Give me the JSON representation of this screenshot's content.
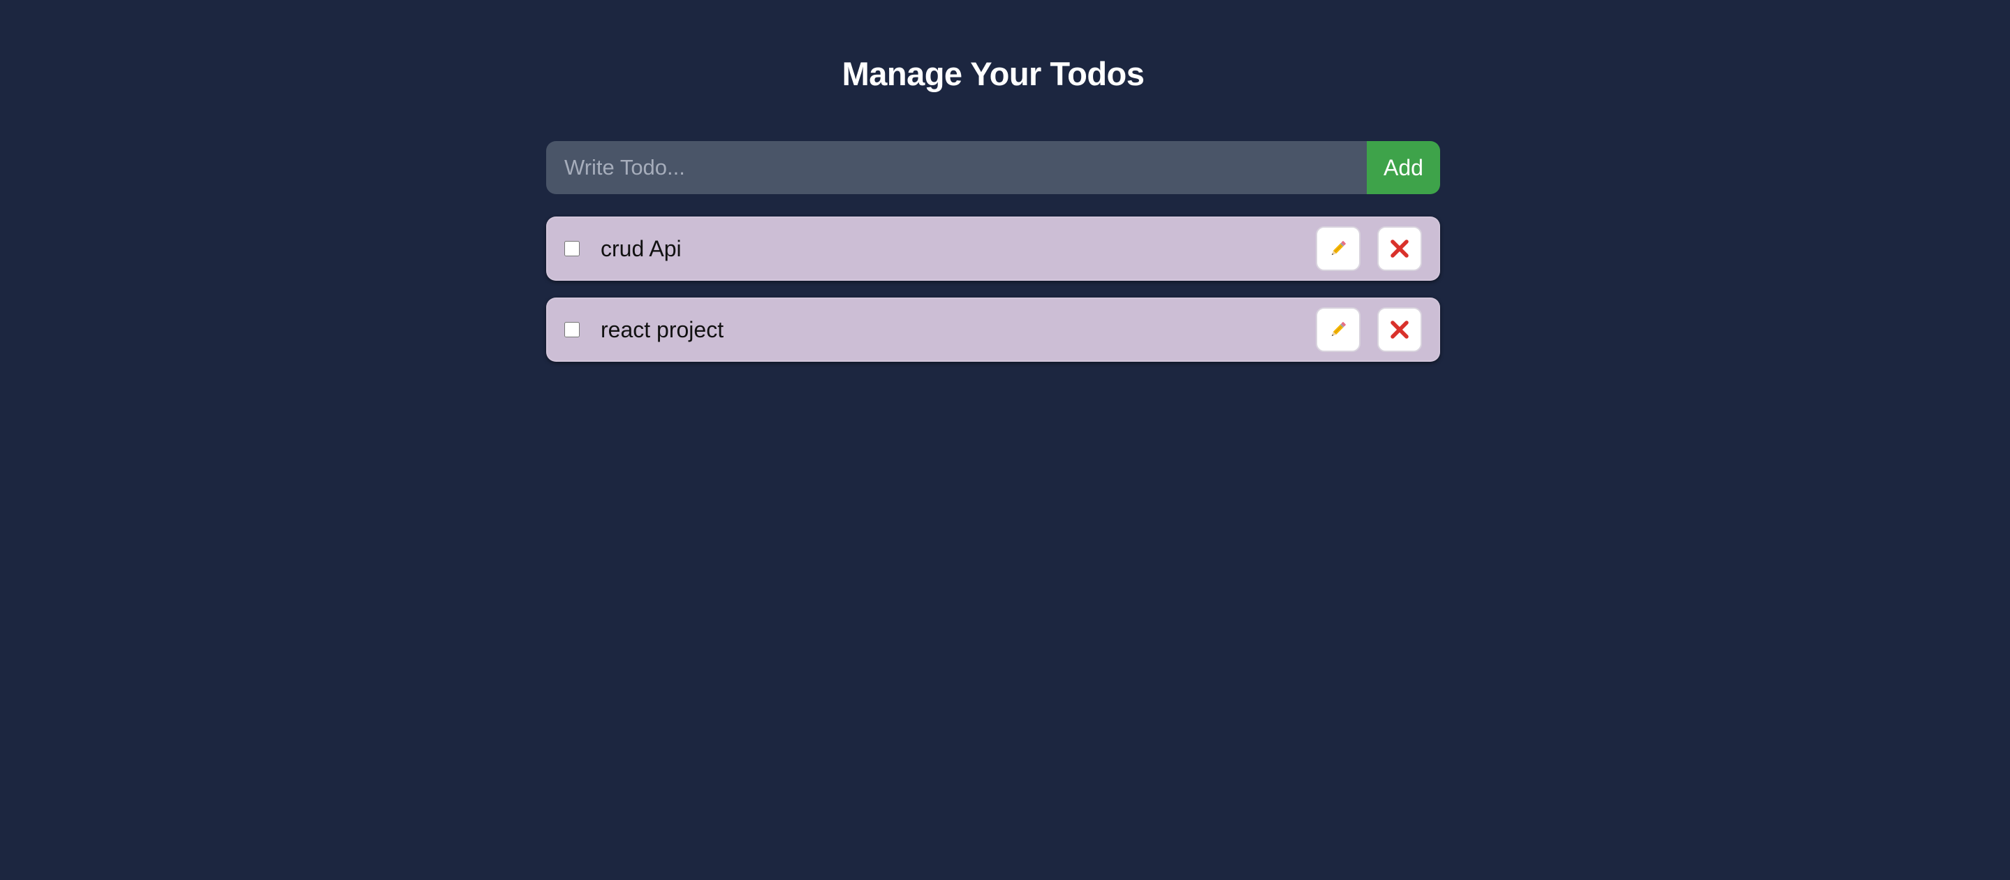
{
  "header": {
    "title": "Manage Your Todos"
  },
  "form": {
    "input_placeholder": "Write Todo...",
    "input_value": "",
    "add_label": "Add"
  },
  "todos": [
    {
      "text": "crud Api",
      "completed": false,
      "edit_icon": "pencil-icon",
      "delete_icon": "close-icon"
    },
    {
      "text": "react project",
      "completed": false,
      "edit_icon": "pencil-icon",
      "delete_icon": "close-icon"
    }
  ],
  "colors": {
    "background": "#1c2640",
    "input_bg": "#4a5568",
    "add_button": "#3ea34a",
    "item_bg": "#ccbed5",
    "delete_icon": "#d9312b"
  }
}
